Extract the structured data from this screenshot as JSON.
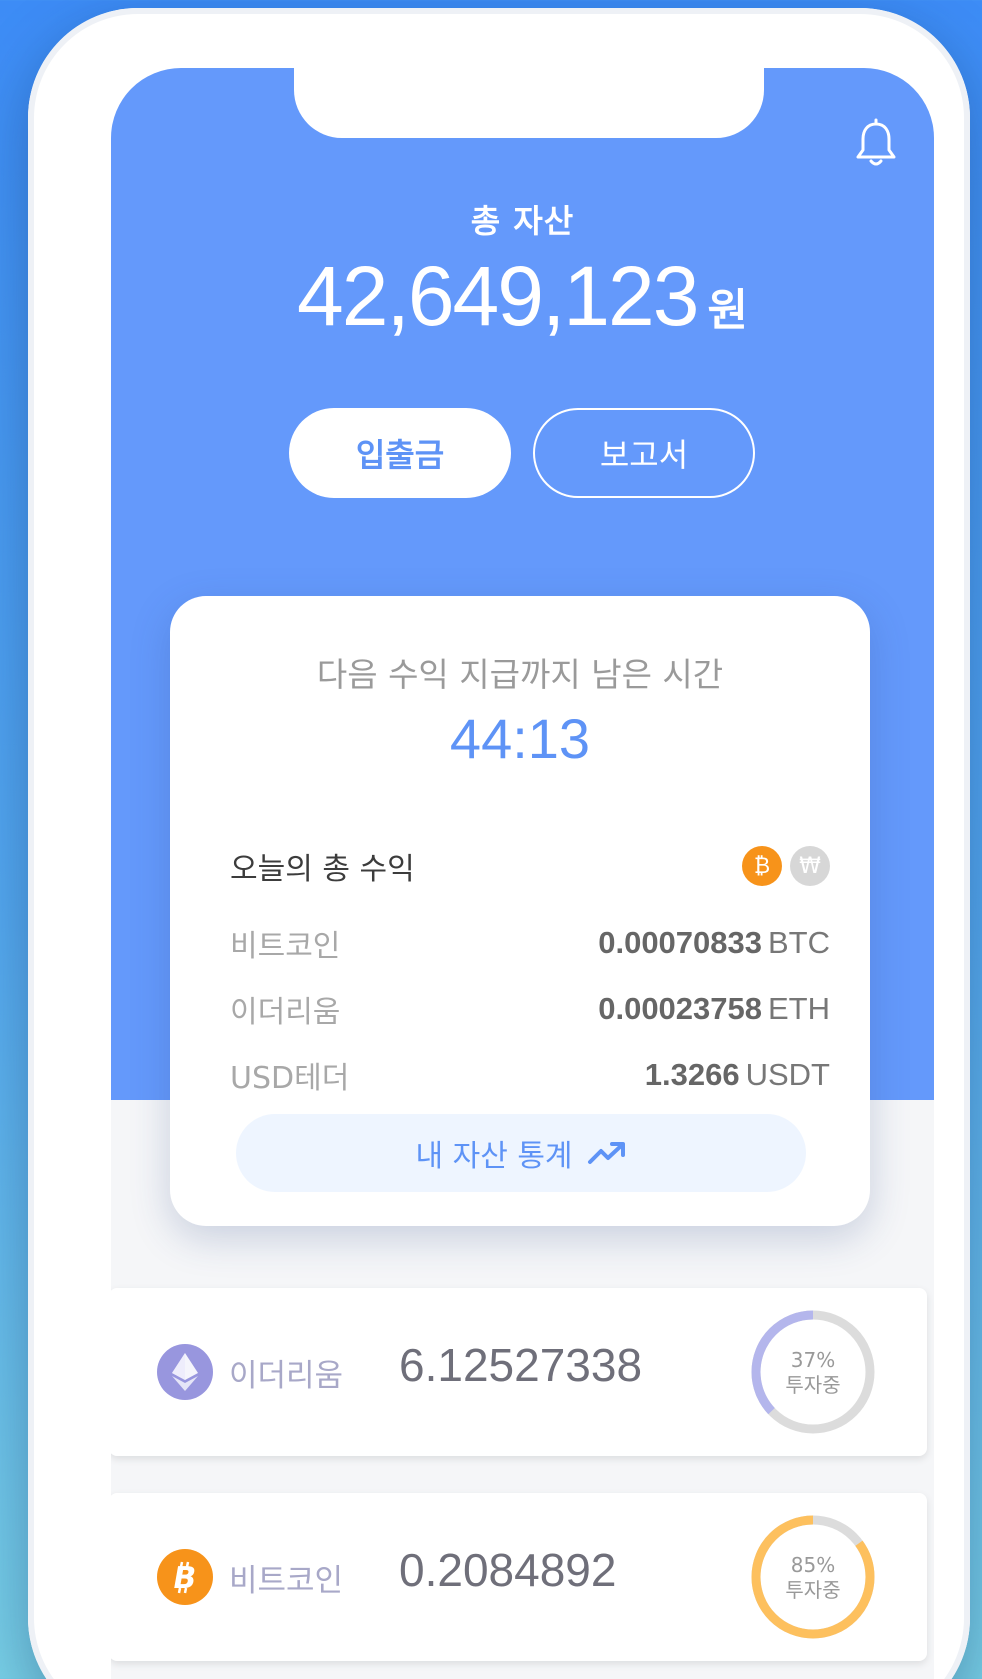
{
  "header": {
    "total_label": "총 자산",
    "total_amount": "42,649,123",
    "total_unit": "원",
    "deposit_label": "입출금",
    "report_label": "보고서",
    "bell_icon": "bell-icon"
  },
  "card": {
    "title": "다음 수익 지급까지 남은 시간",
    "timer": "44:13",
    "today_label": "오늘의 총 수익",
    "toggle_btc": "₿",
    "toggle_krw": "₩",
    "rows": [
      {
        "name": "비트코인",
        "value": "0.00070833",
        "unit": "BTC"
      },
      {
        "name": "이더리움",
        "value": "0.00023758",
        "unit": "ETH"
      },
      {
        "name": "USD테더",
        "value": "1.3266",
        "unit": "USDT"
      }
    ],
    "stats_label": "내 자산 통계"
  },
  "assets": [
    {
      "name": "이더리움",
      "amount": "6.12527338",
      "percent": 37,
      "percent_label": "37%",
      "status": "투자중",
      "color": "#b4b6ec",
      "icon": "ethereum-icon"
    },
    {
      "name": "비트코인",
      "amount": "0.2084892",
      "percent": 85,
      "percent_label": "85%",
      "status": "투자중",
      "color": "#fdc05e",
      "icon": "bitcoin-icon"
    }
  ],
  "colors": {
    "primary": "#6499fb",
    "accent_blue": "#5e93f6",
    "btc_orange": "#f7931a",
    "eth_purple": "#9896de"
  }
}
